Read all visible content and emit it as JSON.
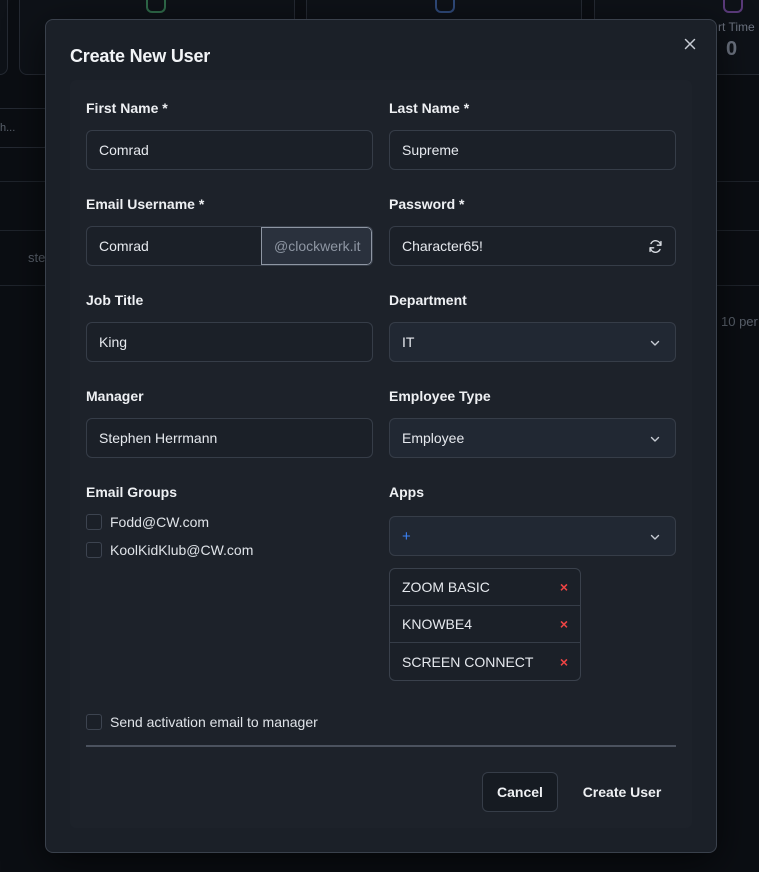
{
  "background": {
    "stat_label": "rt Time",
    "stat_value": "0",
    "search_fragment": "h...",
    "row_fragment": "ste",
    "pager_fragment": "10 per"
  },
  "modal": {
    "title": "Create New User",
    "fields": {
      "first_name": {
        "label": "First Name *",
        "value": "Comrad"
      },
      "last_name": {
        "label": "Last Name *",
        "value": "Supreme"
      },
      "email_username": {
        "label": "Email Username *",
        "value": "Comrad",
        "domain": "@clockwerk.it"
      },
      "password": {
        "label": "Password *",
        "value": "Character65!"
      },
      "job_title": {
        "label": "Job Title",
        "value": "King"
      },
      "department": {
        "label": "Department",
        "value": "IT"
      },
      "manager": {
        "label": "Manager",
        "value": "Stephen Herrmann"
      },
      "employee_type": {
        "label": "Employee Type",
        "value": "Employee"
      }
    },
    "email_groups": {
      "label": "Email Groups",
      "items": [
        "Fodd@CW.com",
        "KoolKidKlub@CW.com"
      ]
    },
    "apps": {
      "label": "Apps",
      "placeholder": "+",
      "selected": [
        "ZOOM BASIC",
        "KNOWBE4",
        "SCREEN CONNECT"
      ]
    },
    "activation_label": "Send activation email to manager",
    "cancel_label": "Cancel",
    "create_label": "Create User"
  },
  "colors": {
    "accent": "#3b82f6",
    "danger": "#ef4444",
    "modal_bg": "#1b2028"
  }
}
